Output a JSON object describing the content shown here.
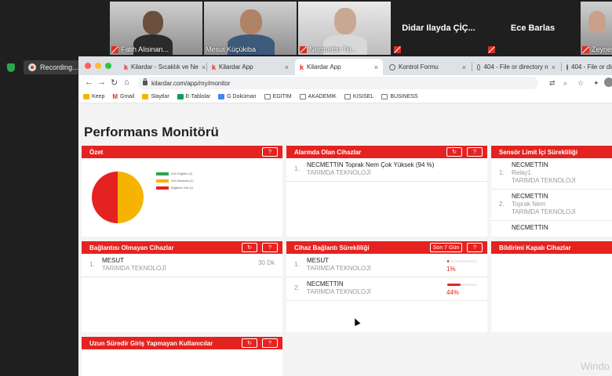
{
  "zoom": {
    "participants": [
      {
        "name": "Fatih Alisinan...",
        "video": true
      },
      {
        "name": "Mesut Küçükiba",
        "video": true
      },
      {
        "name": "Necmettin Tü...",
        "video": true
      },
      {
        "name": "Didar Ilayda ÇİÇ...",
        "video": false
      },
      {
        "name": "Ece Barlas",
        "video": false
      },
      {
        "name": "Zeynep",
        "video": true
      }
    ],
    "recording_label": "Recording..."
  },
  "browser": {
    "tabs": [
      {
        "label": "Kilardar - Sıcaklık ve Ne",
        "favicon": "k"
      },
      {
        "label": "Kilardar App",
        "favicon": "k"
      },
      {
        "label": "Kilardar App",
        "favicon": "k",
        "active": true
      },
      {
        "label": "Kontrol Formu",
        "favicon": "globe"
      },
      {
        "label": "404 - File or directory n",
        "favicon": "globe"
      },
      {
        "label": "404 - File or dir",
        "favicon": "globe"
      }
    ],
    "url": "kilardar.com/app/my/monitor",
    "bookmarks": [
      {
        "label": "Keep",
        "color": "#f6b400"
      },
      {
        "label": "Gmail",
        "color": "#d93025"
      },
      {
        "label": "Slaytlar",
        "color": "#f6b400"
      },
      {
        "label": "E-Tablolar",
        "color": "#0f9d58"
      },
      {
        "label": "G Doküman",
        "color": "#4285f4"
      },
      {
        "label": "EGITIM",
        "color": "#777"
      },
      {
        "label": "AKADEMIK",
        "color": "#777"
      },
      {
        "label": "KISISEL",
        "color": "#777"
      },
      {
        "label": "BUSINESS",
        "color": "#777"
      }
    ]
  },
  "page": {
    "title": "Performans Monitörü",
    "cards": {
      "ozet": {
        "title": "Özet",
        "help": "?",
        "legend": [
          {
            "label": "Veri Sağlıklı (0)",
            "color": "#2ea44f"
          },
          {
            "label": "Veri Alarmda (1)",
            "color": "#f6b400"
          },
          {
            "label": "Bağlantı Yok (1)",
            "color": "#e42320"
          }
        ],
        "chart_values": [
          0,
          1,
          1
        ]
      },
      "alarm": {
        "title": "Alarmda Olan Cihazlar",
        "refresh": "↻",
        "help": "?",
        "rows": [
          {
            "num": "1.",
            "name": "NECMETTIN Toprak Nem Çok Yüksek (94 %)",
            "sub": "TARIMDA TEKNOLOJİ"
          }
        ]
      },
      "sensor": {
        "title": "Sensör Limit İçi Sürekliliği",
        "rows": [
          {
            "num": "1.",
            "name": "NECMETTIN",
            "sub1": "Relay1",
            "sub2": "TARIMDA TEKNOLOJİ"
          },
          {
            "num": "2.",
            "name": "NECMETTIN",
            "sub1": "Toprak Nem",
            "sub2": "TARIMDA TEKNOLOJİ"
          },
          {
            "num": "",
            "name": "NECMETTIN",
            "sub1": "",
            "sub2": ""
          }
        ]
      },
      "offline": {
        "title": "Bağlantısı Olmayan Cihazlar",
        "refresh": "↻",
        "help": "?",
        "rows": [
          {
            "num": "1.",
            "name": "MESUT",
            "sub": "TARIMDA TEKNOLOJİ",
            "right": "30 Dk"
          }
        ]
      },
      "connectivity": {
        "title": "Cihaz Bağlantı Sürekliliği",
        "period": "Son 7 Gün",
        "help": "?",
        "rows": [
          {
            "num": "1.",
            "name": "MESUT",
            "sub": "TARIMDA TEKNOLOJİ",
            "pct": "1%",
            "value": 0.01
          },
          {
            "num": "2.",
            "name": "NECMETTIN",
            "sub": "TARIMDA TEKNOLOJİ",
            "pct": "44%",
            "value": 0.44
          }
        ]
      },
      "notifications": {
        "title": "Bildirimi Kapalı Cihazlar"
      },
      "longlogin": {
        "title": "Uzun Süredir Giriş Yapmayan Kullanıcılar",
        "refresh": "↻",
        "help": "?"
      }
    }
  },
  "watermark": "Windo"
}
